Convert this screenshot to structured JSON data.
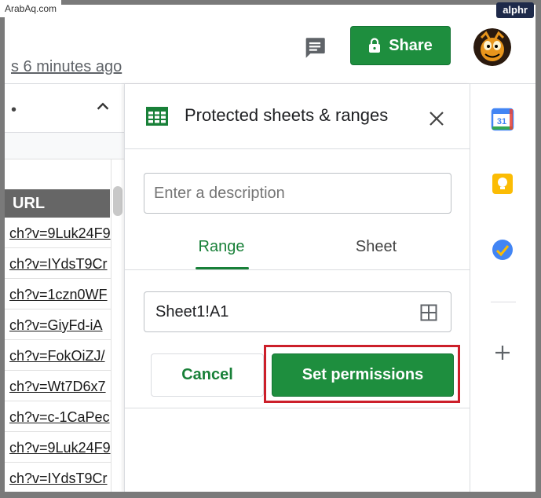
{
  "watermarks": {
    "source": "ArabAq.com",
    "brand": "alphr"
  },
  "header": {
    "last_edit": "s 6 minutes ago",
    "share_label": "Share",
    "icons": {
      "comment": "comment-icon",
      "lock": "lock-icon"
    }
  },
  "sheet": {
    "column_header": "URL",
    "urls": [
      "ch?v=9Luk24F9",
      "ch?v=IYdsT9Cr",
      "ch?v=1czn0WF",
      "ch?v=GiyFd-iA",
      "ch?v=FokOiZJ/",
      "ch?v=Wt7D6x7",
      "ch?v=c-1CaPec",
      "ch?v=9Luk24F9",
      "ch?v=IYdsT9Cr"
    ]
  },
  "panel": {
    "title": "Protected sheets & ranges",
    "description_placeholder": "Enter a description",
    "tabs": {
      "range": "Range",
      "sheet": "Sheet",
      "active": "range"
    },
    "range_value": "Sheet1!A1",
    "cancel_label": "Cancel",
    "set_permissions_label": "Set permissions"
  },
  "rail": {
    "calendar_day": "31",
    "items": [
      "calendar-icon",
      "keep-icon",
      "tasks-icon",
      "add-icon"
    ]
  },
  "colors": {
    "accent_green": "#1e8e3e",
    "highlight_red": "#cc1f2a",
    "url_header_bg": "#666666"
  }
}
